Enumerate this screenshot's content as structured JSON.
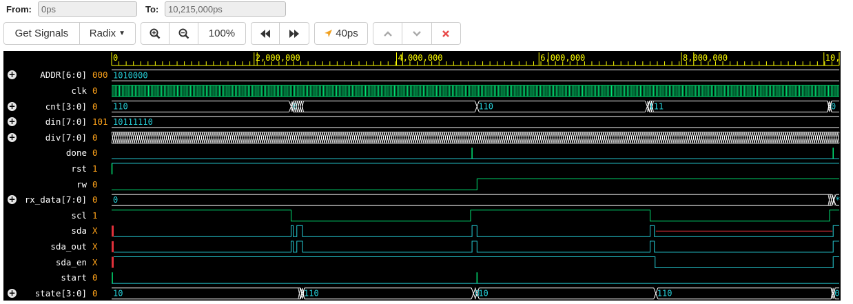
{
  "range": {
    "from_label": "From:",
    "from_value": "0ps",
    "to_label": "To:",
    "to_value": "10,215,000ps"
  },
  "toolbar": {
    "get_signals": "Get Signals",
    "radix": "Radix",
    "zoom_level": "100%",
    "cursor_time": "40ps"
  },
  "icons": {
    "zoom_in": "zoom-in-icon",
    "zoom_out": "zoom-out-icon",
    "rewind": "fast-backward-icon",
    "forward": "fast-forward-icon",
    "cursor": "location-arrow-icon",
    "up": "chevron-up-icon",
    "down": "chevron-down-icon",
    "close": "close-icon"
  },
  "colors": {
    "background": "#000000",
    "ruler": "#ffff00",
    "wave_green": "#00e676",
    "bus_text": "#26d0d9",
    "value": "#ffa31a",
    "undefined": "#e0303a"
  },
  "timeline": {
    "start": 0,
    "end": 10215000,
    "major_ticks": [
      {
        "t": 0,
        "label": "0"
      },
      {
        "t": 2000000,
        "label": "2,000,000"
      },
      {
        "t": 4000000,
        "label": "4,000,000"
      },
      {
        "t": 6000000,
        "label": "6,000,000"
      },
      {
        "t": 8000000,
        "label": "8,000,000"
      },
      {
        "t": 10000000,
        "label": "10,"
      }
    ]
  },
  "signals": [
    {
      "name": "ADDR[6:0]",
      "value": "000",
      "expandable": true,
      "type": "bus",
      "segments": [
        {
          "t": 0,
          "label": "1010000"
        }
      ]
    },
    {
      "name": "clk",
      "value": "0",
      "expandable": false,
      "type": "clock"
    },
    {
      "name": "cnt[3:0]",
      "value": "0",
      "expandable": true,
      "type": "bus",
      "segments": [
        {
          "t": 0,
          "label": "110"
        },
        {
          "t": 2520000,
          "label": "0"
        },
        {
          "t": 5130000,
          "label": "110"
        },
        {
          "t": 7520000,
          "label": "111"
        },
        {
          "t": 10080000,
          "label": "0"
        }
      ],
      "hatch": [
        [
          2520000,
          2690000
        ],
        [
          7520000,
          7600000
        ],
        [
          10050000,
          10100000
        ]
      ]
    },
    {
      "name": "din[7:0]",
      "value": "101",
      "expandable": true,
      "type": "bus",
      "segments": [
        {
          "t": 0,
          "label": "10111110"
        }
      ]
    },
    {
      "name": "div[7:0]",
      "value": "0",
      "expandable": true,
      "type": "dense"
    },
    {
      "name": "done",
      "value": "0",
      "expandable": false,
      "type": "bit",
      "level0": 0,
      "pulses": [
        5060000,
        10130000
      ]
    },
    {
      "name": "rst",
      "value": "1",
      "expandable": false,
      "type": "bit",
      "init": 1,
      "edges": [],
      "pulses": [
        5000
      ]
    },
    {
      "name": "rw",
      "value": "0",
      "expandable": false,
      "type": "bit",
      "init": 0,
      "edges": [
        5130000
      ]
    },
    {
      "name": "rx_data[7:0]",
      "value": "0",
      "expandable": true,
      "type": "bus",
      "segments": [
        {
          "t": 0,
          "label": "0"
        },
        {
          "t": 10140000,
          "label": "*"
        }
      ],
      "hatch": [
        [
          10060000,
          10140000
        ]
      ]
    },
    {
      "name": "scl",
      "value": "1",
      "expandable": false,
      "type": "bit",
      "init": 1,
      "edges": [
        2520000,
        5040000,
        7560000,
        10080000
      ]
    },
    {
      "name": "sda",
      "value": "X",
      "expandable": false,
      "type": "bit-x",
      "init": 0,
      "edges": [
        2520000,
        2550000,
        2600000,
        2680000,
        5060000,
        5130000,
        7560000,
        7620000,
        10130000
      ],
      "xzone": [
        [
          7640000,
          10120000
        ]
      ]
    },
    {
      "name": "sda_out",
      "value": "X",
      "expandable": false,
      "type": "bit-x",
      "init": 0,
      "edges": [
        2520000,
        2550000,
        2600000,
        2680000,
        5060000,
        5130000,
        7560000,
        7620000,
        10130000
      ]
    },
    {
      "name": "sda_en",
      "value": "X",
      "expandable": false,
      "type": "bit-x",
      "init": 1,
      "edges": [
        7630000,
        10130000
      ]
    },
    {
      "name": "start",
      "value": "0",
      "expandable": false,
      "type": "bit",
      "init": 0,
      "pulses": [
        10000,
        5130000
      ]
    },
    {
      "name": "state[3:0]",
      "value": "0",
      "expandable": true,
      "type": "bus",
      "segments": [
        {
          "t": 0,
          "label": "10"
        },
        {
          "t": 2680000,
          "label": "110"
        },
        {
          "t": 5080000,
          "label": "0"
        },
        {
          "t": 5130000,
          "label": "10"
        },
        {
          "t": 7640000,
          "label": "110"
        },
        {
          "t": 10130000,
          "label": "0"
        }
      ],
      "hatch": [
        [
          2620000,
          2680000
        ],
        [
          10100000,
          10130000
        ]
      ]
    }
  ]
}
